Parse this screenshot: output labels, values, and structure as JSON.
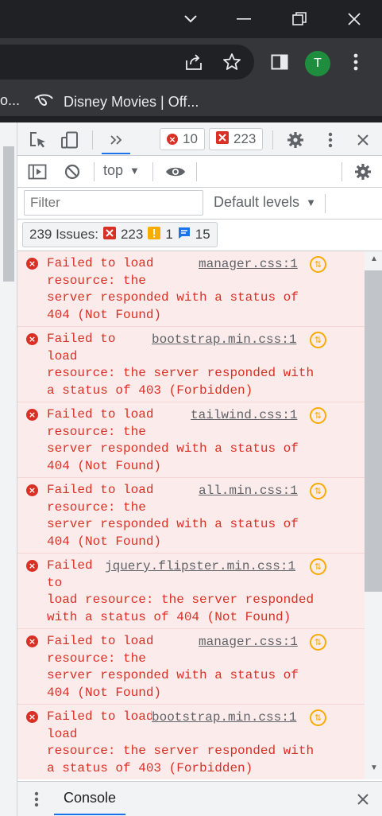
{
  "browser": {
    "avatar_letter": "T",
    "bookmarks": {
      "left_truncated": "o...",
      "item_label": "Disney Movies | Off..."
    }
  },
  "devtools": {
    "top": {
      "errors_count": "10",
      "issues_count": "223"
    },
    "context": {
      "value": "top",
      "arrow": "▼"
    },
    "filter": {
      "placeholder": "Filter"
    },
    "levels": {
      "label": "Default levels",
      "arrow": "▼"
    },
    "issues_bar": {
      "label": "239 Issues:",
      "errors": "223",
      "warnings": "1",
      "info": "15"
    },
    "entries": [
      {
        "lines": "Failed to load\nresource: the\nserver responded with a status of\n404 (Not Found)",
        "source": "manager.css:1"
      },
      {
        "lines": "Failed to\nload\nresource: the server responded with\na status of 403 (Forbidden)",
        "source": "bootstrap.min.css:1"
      },
      {
        "lines": "Failed to load\nresource: the\nserver responded with a status of\n404 (Not Found)",
        "source": "tailwind.css:1"
      },
      {
        "lines": "Failed to load\nresource: the\nserver responded with a status of\n404 (Not Found)",
        "source": "all.min.css:1"
      },
      {
        "lines": "Failed\nto\nload resource: the server responded\nwith a status of 404 (Not Found)",
        "source": "jquery.flipster.min.css:1"
      },
      {
        "lines": "Failed to load\nresource: the\nserver responded with a status of\n404 (Not Found)",
        "source": "manager.css:1"
      },
      {
        "lines": "Failed to load\nload\nresource: the server responded with\na status of 403 (Forbidden)",
        "source": "bootstrap.min.css:1"
      }
    ],
    "drawer": {
      "tab_label": "Console"
    }
  },
  "colors": {
    "error": "#d93025",
    "warning": "#f9ab00",
    "info": "#1a73e8",
    "devtools_bg": "#f1f3f4",
    "error_row_bg": "#fcebeb"
  }
}
